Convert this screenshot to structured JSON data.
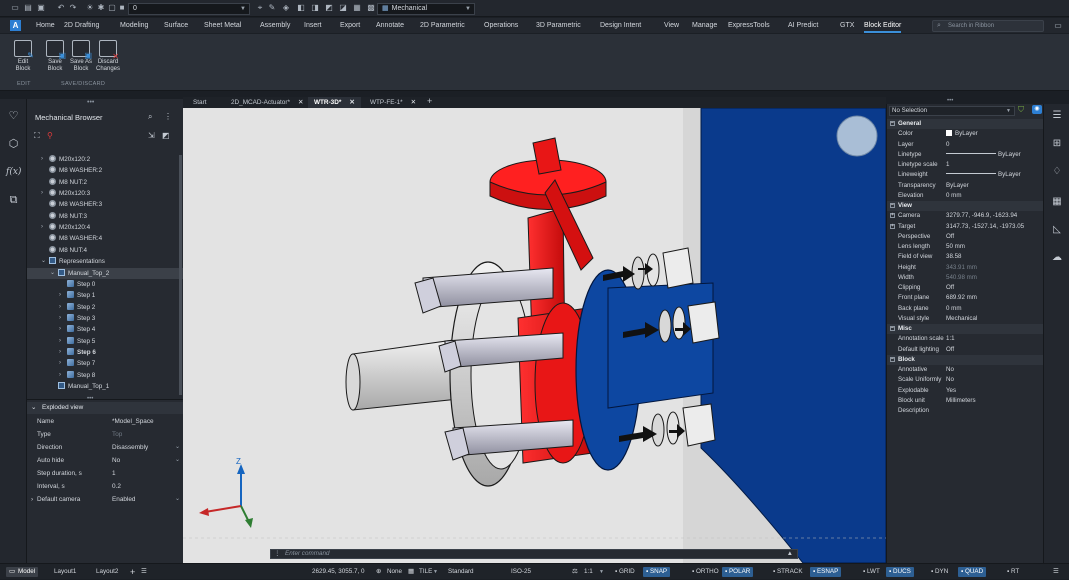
{
  "qat": {
    "layer_value": "0",
    "workspace": "Mechanical"
  },
  "menu": {
    "items": [
      "Home",
      "2D Drafting",
      "Modeling",
      "Surface",
      "Sheet Metal",
      "Assembly",
      "Insert",
      "Export",
      "Annotate",
      "2D Parametric",
      "Operations",
      "3D Parametric",
      "Design Intent",
      "View",
      "Manage",
      "ExpressTools",
      "AI Predict",
      "GTX",
      "Block Editor"
    ],
    "logo": "A",
    "search_placeholder": "Search in Ribbon"
  },
  "ribbon": {
    "buttons": [
      {
        "line1": "Edit",
        "line2": "Block"
      },
      {
        "line1": "Save",
        "line2": "Block"
      },
      {
        "line1": "Save As",
        "line2": "Block"
      },
      {
        "line1": "Discard",
        "line2": "Changes"
      }
    ],
    "groups": [
      "EDIT",
      "SAVE/DISCARD"
    ]
  },
  "left_icons": [
    "bulb-icon",
    "cube-icon",
    "function-icon",
    "layers-icon"
  ],
  "function_label": "f(x)",
  "browser": {
    "title": "Mechanical Browser",
    "tree": [
      {
        "label": "M20x120:2",
        "type": "bolt",
        "indent": 1,
        "chev": true
      },
      {
        "label": "M8 WASHER:2",
        "type": "bolt",
        "indent": 1
      },
      {
        "label": "M8 NUT:2",
        "type": "bolt",
        "indent": 1
      },
      {
        "label": "M20x120:3",
        "type": "bolt",
        "indent": 1,
        "chev": true
      },
      {
        "label": "M8 WASHER:3",
        "type": "bolt",
        "indent": 1
      },
      {
        "label": "M8 NUT:3",
        "type": "bolt",
        "indent": 1
      },
      {
        "label": "M20x120:4",
        "type": "bolt",
        "indent": 1,
        "chev": true
      },
      {
        "label": "M8 WASHER:4",
        "type": "bolt",
        "indent": 1
      },
      {
        "label": "M8 NUT:4",
        "type": "bolt",
        "indent": 1
      },
      {
        "label": "Representations",
        "type": "rep",
        "indent": 1,
        "chev": true,
        "open": true
      },
      {
        "label": "Manual_Top_2",
        "type": "rep",
        "indent": 2,
        "chev": true,
        "open": true,
        "sel": true
      },
      {
        "label": "Step 0",
        "type": "step",
        "indent": 3
      },
      {
        "label": "Step 1",
        "type": "step",
        "indent": 3,
        "chev": true
      },
      {
        "label": "Step 2",
        "type": "step",
        "indent": 3,
        "chev": true
      },
      {
        "label": "Step 3",
        "type": "step",
        "indent": 3,
        "chev": true
      },
      {
        "label": "Step 4",
        "type": "step",
        "indent": 3,
        "chev": true
      },
      {
        "label": "Step 5",
        "type": "step",
        "indent": 3,
        "chev": true
      },
      {
        "label": "Step 6",
        "type": "step",
        "indent": 3,
        "chev": true,
        "bold": true
      },
      {
        "label": "Step 7",
        "type": "step",
        "indent": 3,
        "chev": true
      },
      {
        "label": "Step 8",
        "type": "step",
        "indent": 3,
        "chev": true
      },
      {
        "label": "Manual_Top_1",
        "type": "rep",
        "indent": 2
      }
    ],
    "props_title": "Exploded view",
    "props": [
      {
        "k": "Name",
        "v": "*Model_Space"
      },
      {
        "k": "Type",
        "v": "Top",
        "dim": true
      },
      {
        "k": "Direction",
        "v": "Disassembly",
        "dd": true
      },
      {
        "k": "Auto hide",
        "v": "No",
        "dd": true
      },
      {
        "k": "Step duration, s",
        "v": "1"
      },
      {
        "k": "Interval, s",
        "v": "0.2"
      },
      {
        "k": "Default camera",
        "v": "Enabled",
        "dd": true,
        "chev": true
      }
    ]
  },
  "tabs": [
    {
      "label": "Start"
    },
    {
      "label": "2D_MCAD-Actuator*",
      "close": true
    },
    {
      "label": "WTR-3D*",
      "close": true,
      "active": true
    },
    {
      "label": "WTP-FE-1*",
      "close": true
    }
  ],
  "command_placeholder": "Enter command",
  "axis": {
    "z": "Z",
    "y": "Y",
    "x": "X"
  },
  "properties": {
    "selection": "No Selection",
    "rows": [
      {
        "sec": "General"
      },
      {
        "k": "Color",
        "v": "ByLayer",
        "swatch": true
      },
      {
        "k": "Layer",
        "v": "0"
      },
      {
        "k": "Linetype",
        "v": "ByLayer",
        "line": true
      },
      {
        "k": "Linetype scale",
        "v": "1"
      },
      {
        "k": "Lineweight",
        "v": "ByLayer",
        "line": true
      },
      {
        "k": "Transparency",
        "v": "ByLayer"
      },
      {
        "k": "Elevation",
        "v": "0 mm"
      },
      {
        "sec": "View"
      },
      {
        "k": "Camera",
        "v": "3279.77, -946.9, -1623.94",
        "plus": true
      },
      {
        "k": "Target",
        "v": "3147.73, -1527.14, -1973.05",
        "plus": true
      },
      {
        "k": "Perspective",
        "v": "Off"
      },
      {
        "k": "Lens length",
        "v": "50 mm"
      },
      {
        "k": "Field of view",
        "v": "38.58"
      },
      {
        "k": "Height",
        "v": "343.91 mm",
        "dim": true
      },
      {
        "k": "Width",
        "v": "540.98 mm",
        "dim": true
      },
      {
        "k": "Clipping",
        "v": "Off"
      },
      {
        "k": "Front plane",
        "v": "689.92 mm"
      },
      {
        "k": "Back plane",
        "v": "0 mm"
      },
      {
        "k": "Visual style",
        "v": "Mechanical"
      },
      {
        "sec": "Misc"
      },
      {
        "k": "Annotation scale",
        "v": "1:1"
      },
      {
        "k": "Default lighting",
        "v": "Off"
      },
      {
        "sec": "Block"
      },
      {
        "k": "Annotative",
        "v": "No"
      },
      {
        "k": "Scale Uniformly",
        "v": "No"
      },
      {
        "k": "Explodable",
        "v": "Yes"
      },
      {
        "k": "Block unit",
        "v": "Millimeters"
      },
      {
        "k": "Description",
        "v": ""
      }
    ]
  },
  "right_icons": [
    "sliders-icon",
    "grid-icon",
    "balloon-icon",
    "table-icon",
    "drawing-icon",
    "cloud-icon"
  ],
  "status": {
    "tabs": [
      "Model",
      "Layout1",
      "Layout2"
    ],
    "coords": "2629.45, 3055.7, 0",
    "none": "None",
    "tile": "TILE",
    "style": "Standard",
    "iso": "ISO-25",
    "scale": "1:1",
    "toggles": [
      {
        "label": "GRID",
        "on": false
      },
      {
        "label": "SNAP",
        "on": true
      },
      {
        "label": "ORTHO",
        "on": false
      },
      {
        "label": "POLAR",
        "on": true
      },
      {
        "label": "STRACK",
        "on": false
      },
      {
        "label": "ESNAP",
        "on": true
      },
      {
        "label": "LWT",
        "on": false
      },
      {
        "label": "DUCS",
        "on": true
      },
      {
        "label": "DYN",
        "on": false
      },
      {
        "label": "QUAD",
        "on": true
      },
      {
        "label": "RT",
        "on": false
      }
    ]
  },
  "colors": {
    "accent": "#3b8fd9",
    "valve_red": "#e81616",
    "flange_blue": "#0d47a1",
    "wall_blue": "#0a3a8c",
    "steel": "#dcdcdc"
  }
}
